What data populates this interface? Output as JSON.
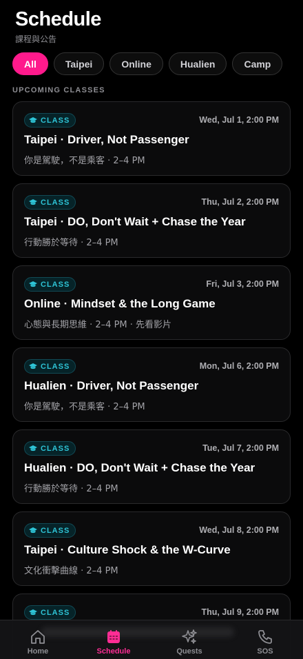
{
  "header": {
    "title": "Schedule",
    "subtitle": "課程與公告"
  },
  "filters": [
    {
      "label": "All",
      "active": true
    },
    {
      "label": "Taipei",
      "active": false
    },
    {
      "label": "Online",
      "active": false
    },
    {
      "label": "Hualien",
      "active": false
    },
    {
      "label": "Camp",
      "active": false
    }
  ],
  "section_label": "UPCOMING CLASSES",
  "classes": [
    {
      "badge": "CLASS",
      "date": "Wed, Jul 1, 2:00 PM",
      "title": "Taipei · Driver, Not Passenger",
      "subtitle": "你是駕駛，不是乘客 · 2–4 PM"
    },
    {
      "badge": "CLASS",
      "date": "Thu, Jul 2, 2:00 PM",
      "title": "Taipei · DO, Don't Wait + Chase the Year",
      "subtitle": "行動勝於等待 · 2–4 PM"
    },
    {
      "badge": "CLASS",
      "date": "Fri, Jul 3, 2:00 PM",
      "title": "Online · Mindset & the Long Game",
      "subtitle": "心態與長期思維 · 2–4 PM · 先看影片"
    },
    {
      "badge": "CLASS",
      "date": "Mon, Jul 6, 2:00 PM",
      "title": "Hualien · Driver, Not Passenger",
      "subtitle": "你是駕駛，不是乘客 · 2–4 PM"
    },
    {
      "badge": "CLASS",
      "date": "Tue, Jul 7, 2:00 PM",
      "title": "Hualien · DO, Don't Wait + Chase the Year",
      "subtitle": "行動勝於等待 · 2–4 PM"
    },
    {
      "badge": "CLASS",
      "date": "Wed, Jul 8, 2:00 PM",
      "title": "Taipei · Culture Shock & the W-Curve",
      "subtitle": "文化衝擊曲線 · 2–4 PM"
    },
    {
      "badge": "CLASS",
      "date": "Thu, Jul 9, 2:00 PM",
      "title": "",
      "subtitle": ""
    }
  ],
  "tabs": [
    {
      "label": "Home",
      "icon": "home-icon",
      "active": false
    },
    {
      "label": "Schedule",
      "icon": "calendar-icon",
      "active": true
    },
    {
      "label": "Quests",
      "icon": "sparkles-icon",
      "active": false
    },
    {
      "label": "SOS",
      "icon": "phone-icon",
      "active": false
    }
  ],
  "colors": {
    "accent": "#ff1a8c",
    "badge": "#2ec4d6",
    "background": "#000000"
  }
}
